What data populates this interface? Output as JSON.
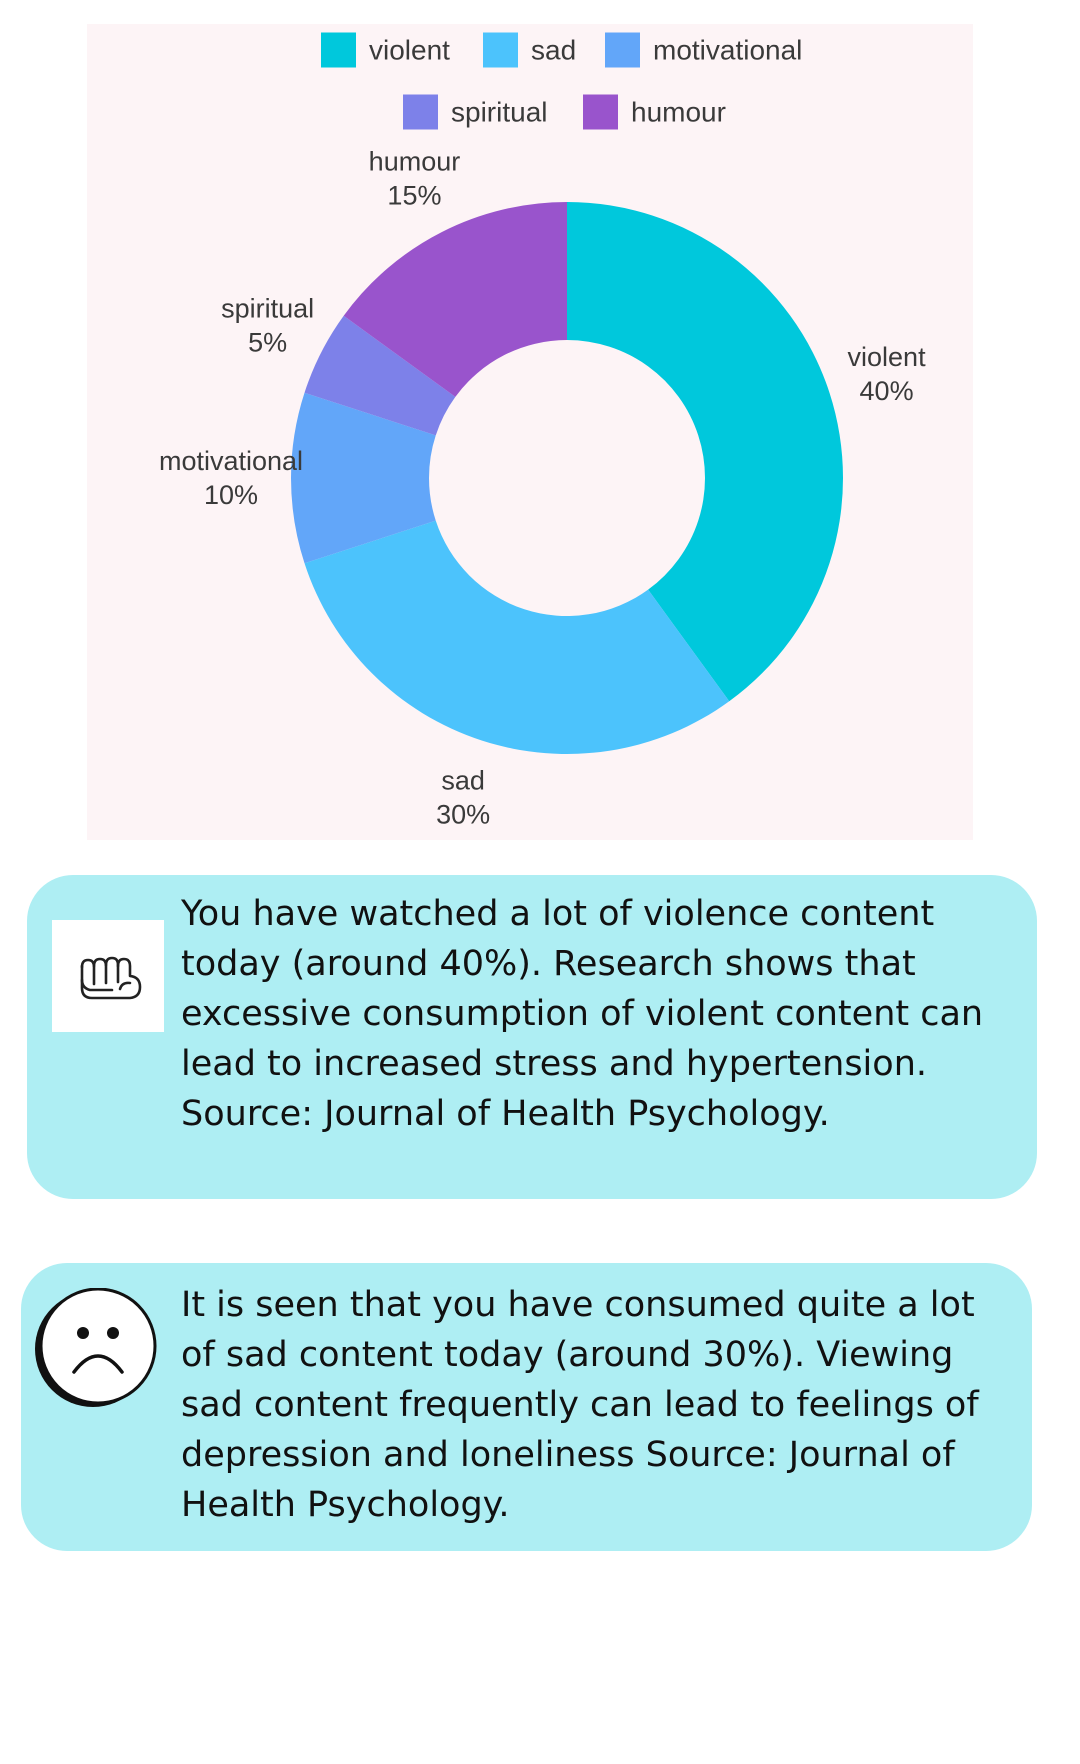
{
  "chart_data": {
    "type": "pie",
    "donut": true,
    "legend_position": "top",
    "categories": [
      "violent",
      "sad",
      "motivational",
      "spiritual",
      "humour"
    ],
    "values": [
      40,
      30,
      10,
      5,
      15
    ],
    "value_labels": [
      "40%",
      "30%",
      "10%",
      "5%",
      "15%"
    ],
    "colors": [
      "#00c8dc",
      "#4cc3fc",
      "#62a6f9",
      "#7d81e9",
      "#9954cc"
    ],
    "panel_background": "#fdf4f6"
  },
  "cards": [
    {
      "icon": "fist-icon",
      "text": "You have watched a lot of violence content today (around 40%). Research shows that excessive consumption of violent content can lead to increased stress and hypertension. Source: Journal of Health Psychology."
    },
    {
      "icon": "sad-face-icon",
      "text": "It is seen that you have consumed quite a lot of sad content today (around 30%). Viewing sad content frequently can lead to feelings of depression and loneliness Source: Journal of Health Psychology."
    }
  ],
  "card_color": "#aeeef3"
}
